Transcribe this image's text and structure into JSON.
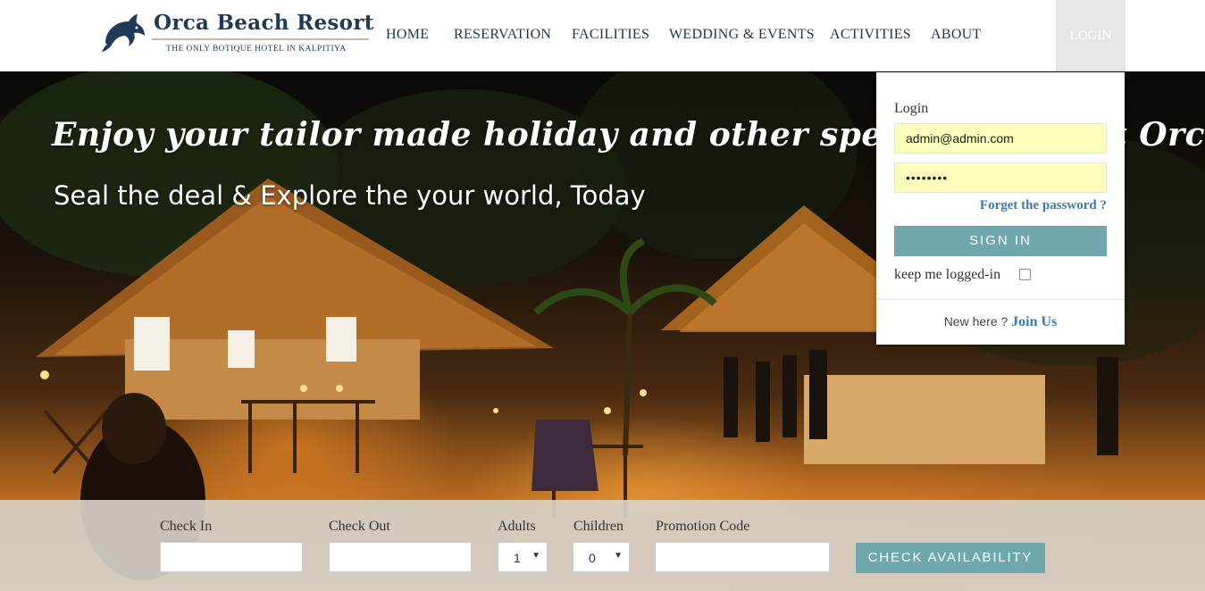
{
  "brand": {
    "title": "Orca Beach Resort",
    "tagline": "THE ONLY BOTIQUE HOTEL IN KALPITIYA",
    "logo_icon": "dolphin-icon"
  },
  "nav": {
    "items": [
      {
        "label": "HOME"
      },
      {
        "label": "RESERVATION"
      },
      {
        "label": "FACILITIES"
      },
      {
        "label": "WEDDING & EVENTS"
      },
      {
        "label": "ACTIVITIES"
      },
      {
        "label": "ABOUT"
      }
    ],
    "login_label": "LOGIN"
  },
  "hero": {
    "title": "Enjoy your tailor made holiday and other special events at Orca Beach Resort",
    "subtitle": "Seal the deal & Explore the your world, Today"
  },
  "login": {
    "title": "Login",
    "email_value": "admin@admin.com",
    "password_value": "••••••••",
    "forgot_label": "Forget the password ?",
    "signin_label": "SIGN IN",
    "keep_label": "keep me logged-in",
    "new_here_label": "New here ? ",
    "join_label": "Join Us"
  },
  "booking": {
    "check_in_label": "Check In",
    "check_out_label": "Check Out",
    "adults_label": "Adults",
    "adults_value": "1",
    "children_label": "Children",
    "children_value": "0",
    "promo_label": "Promotion Code",
    "check_button_label": "CHECK AVAILABILITY"
  },
  "colors": {
    "brand_navy": "#1f3a57",
    "accent_teal": "#6fa7ae",
    "link_blue": "#3a7bb3",
    "autofill_yellow": "#fbfdba"
  }
}
